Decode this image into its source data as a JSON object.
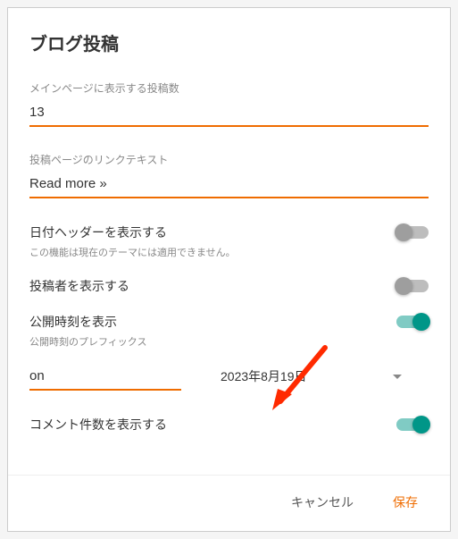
{
  "title": "ブログ投稿",
  "postsCount": {
    "label": "メインページに表示する投稿数",
    "value": "13"
  },
  "linkText": {
    "label": "投稿ページのリンクテキスト",
    "value": "Read more »"
  },
  "dateHeader": {
    "label": "日付ヘッダーを表示する",
    "helper": "この機能は現在のテーマには適用できません。",
    "on": false
  },
  "showAuthor": {
    "label": "投稿者を表示する",
    "on": false
  },
  "showTime": {
    "label": "公開時刻を表示",
    "on": true
  },
  "prefix": {
    "label": "公開時刻のプレフィックス",
    "value": "on"
  },
  "dateFormat": {
    "selected": "2023年8月19日"
  },
  "commentCount": {
    "label": "コメント件数を表示する",
    "on": true
  },
  "buttons": {
    "cancel": "キャンセル",
    "save": "保存"
  }
}
